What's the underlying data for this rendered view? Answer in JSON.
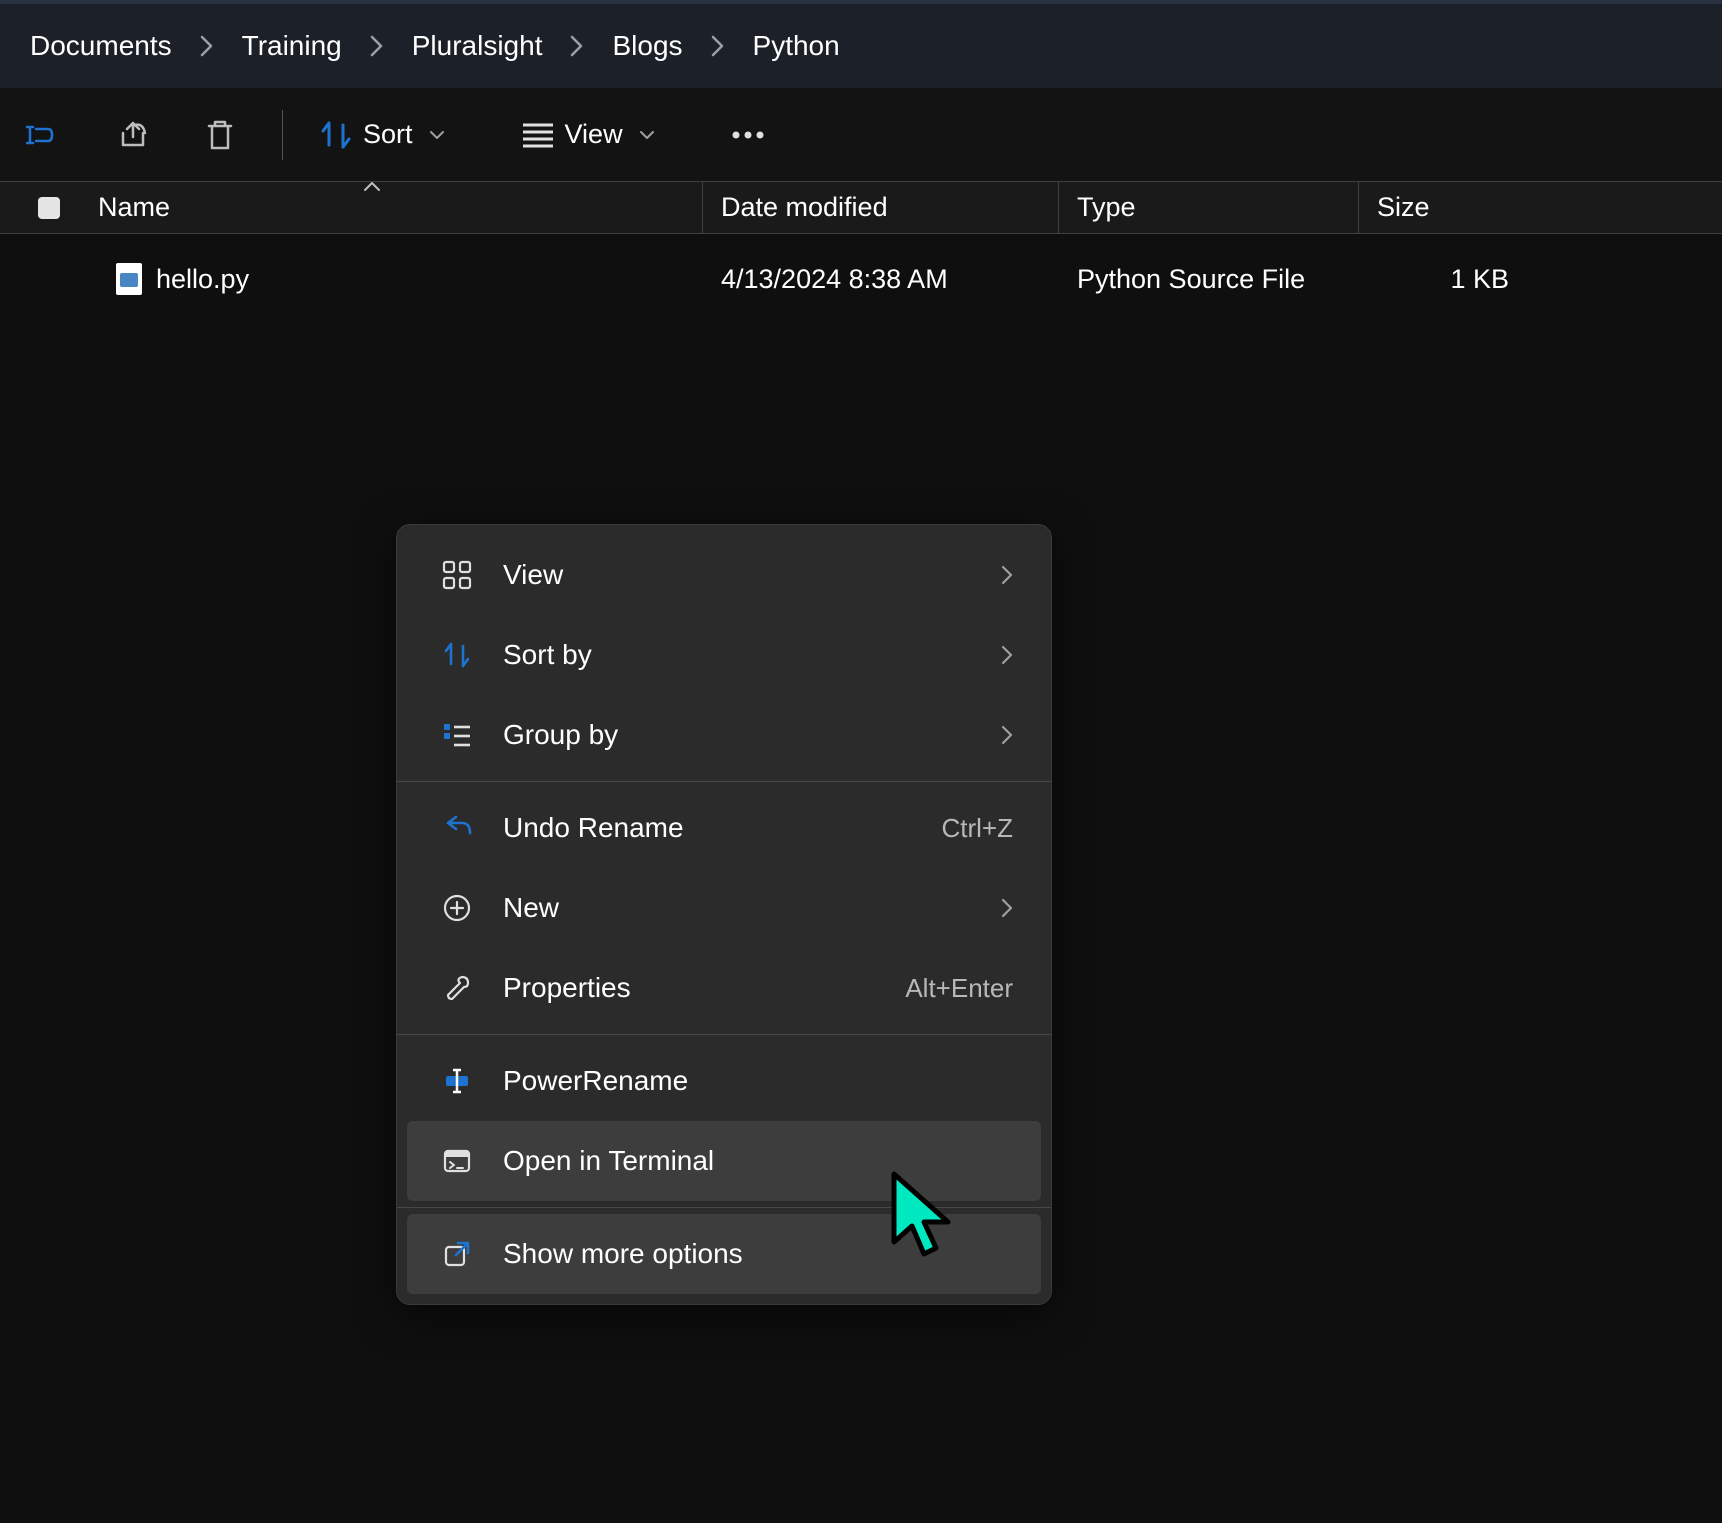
{
  "breadcrumb": [
    "Documents",
    "Training",
    "Pluralsight",
    "Blogs",
    "Python"
  ],
  "toolbar": {
    "sort_label": "Sort",
    "view_label": "View"
  },
  "columns": {
    "name": "Name",
    "date": "Date modified",
    "type": "Type",
    "size": "Size"
  },
  "rows": [
    {
      "name": "hello.py",
      "date": "4/13/2024 8:38 AM",
      "type": "Python Source File",
      "size": "1 KB"
    }
  ],
  "context_menu": {
    "view": "View",
    "sort_by": "Sort by",
    "group_by": "Group by",
    "undo_rename": "Undo Rename",
    "undo_rename_accel": "Ctrl+Z",
    "new": "New",
    "properties": "Properties",
    "properties_accel": "Alt+Enter",
    "power_rename": "PowerRename",
    "open_terminal": "Open in Terminal",
    "show_more": "Show more options"
  }
}
